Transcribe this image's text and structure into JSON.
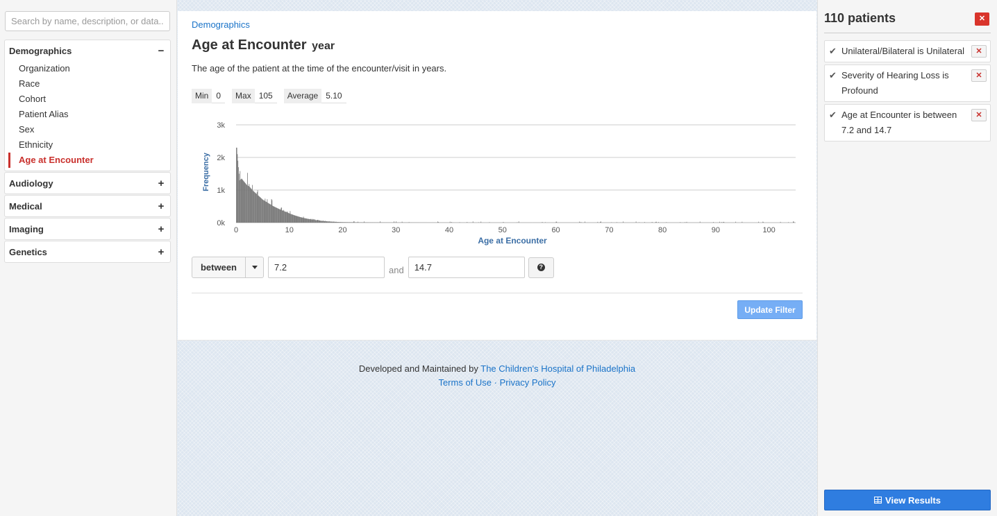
{
  "search": {
    "placeholder": "Search by name, description, or data.."
  },
  "sidebar": {
    "categories": [
      {
        "label": "Demographics",
        "toggle": "−",
        "expanded": true,
        "items": [
          "Organization",
          "Race",
          "Cohort",
          "Patient Alias",
          "Sex",
          "Ethnicity",
          "Age at Encounter"
        ],
        "active_item": "Age at Encounter"
      },
      {
        "label": "Audiology",
        "toggle": "+"
      },
      {
        "label": "Medical",
        "toggle": "+"
      },
      {
        "label": "Imaging",
        "toggle": "+"
      },
      {
        "label": "Genetics",
        "toggle": "+"
      }
    ]
  },
  "main": {
    "breadcrumb": "Demographics",
    "title": "Age at Encounter",
    "unit": "year",
    "description": "The age of the patient at the time of the encounter/visit in years.",
    "stats": {
      "min_label": "Min",
      "min_value": "0",
      "max_label": "Max",
      "max_value": "105",
      "avg_label": "Average",
      "avg_value": "5.10"
    },
    "filter": {
      "operator": "between",
      "low": "7.2",
      "and_label": "and",
      "high": "14.7",
      "help_icon": "question-circle-icon"
    },
    "update_button": "Update Filter"
  },
  "chart_data": {
    "type": "bar",
    "xlabel": "Age at Encounter",
    "ylabel": "Frequency",
    "xlim": [
      0,
      105
    ],
    "ylim": [
      0,
      3000
    ],
    "xticks": [
      0,
      10,
      20,
      30,
      40,
      50,
      60,
      70,
      80,
      90,
      100
    ],
    "yticks": [
      "0k",
      "1k",
      "2k",
      "3k"
    ],
    "ytick_values": [
      0,
      1000,
      2000,
      3000
    ],
    "grid": true,
    "bar_color": "#777777",
    "approx_series": {
      "name": "",
      "x": [
        0.1,
        0.3,
        0.6,
        1,
        1.5,
        2,
        2.5,
        3,
        4,
        5,
        6,
        7,
        8,
        9,
        10,
        11,
        12,
        13,
        14,
        15,
        16,
        17,
        18,
        19,
        20,
        25,
        30,
        40,
        50,
        60,
        70,
        80,
        90,
        100
      ],
      "values": [
        2300,
        1900,
        1300,
        1350,
        1250,
        1150,
        1100,
        1000,
        850,
        700,
        600,
        500,
        420,
        350,
        280,
        220,
        170,
        130,
        100,
        75,
        55,
        40,
        30,
        20,
        15,
        8,
        5,
        3,
        2,
        2,
        2,
        2,
        2,
        1
      ]
    }
  },
  "footer": {
    "developed_by": "Developed and Maintained by",
    "org": "The Children's Hospital of Philadelphia",
    "terms": "Terms of Use",
    "sep": "·",
    "privacy": "Privacy Policy"
  },
  "right": {
    "patient_count": "110 patients",
    "clear_all_icon": "close-icon",
    "filters": [
      "Unilateral/Bilateral is Unilateral",
      "Severity of Hearing Loss is Profound",
      "Age at Encounter is between 7.2 and 14.7"
    ],
    "view_results": "View Results"
  },
  "colors": {
    "accent": "#1a73c8",
    "danger": "#d9342b",
    "primary": "#2f7de0",
    "active": "#c9302c"
  }
}
